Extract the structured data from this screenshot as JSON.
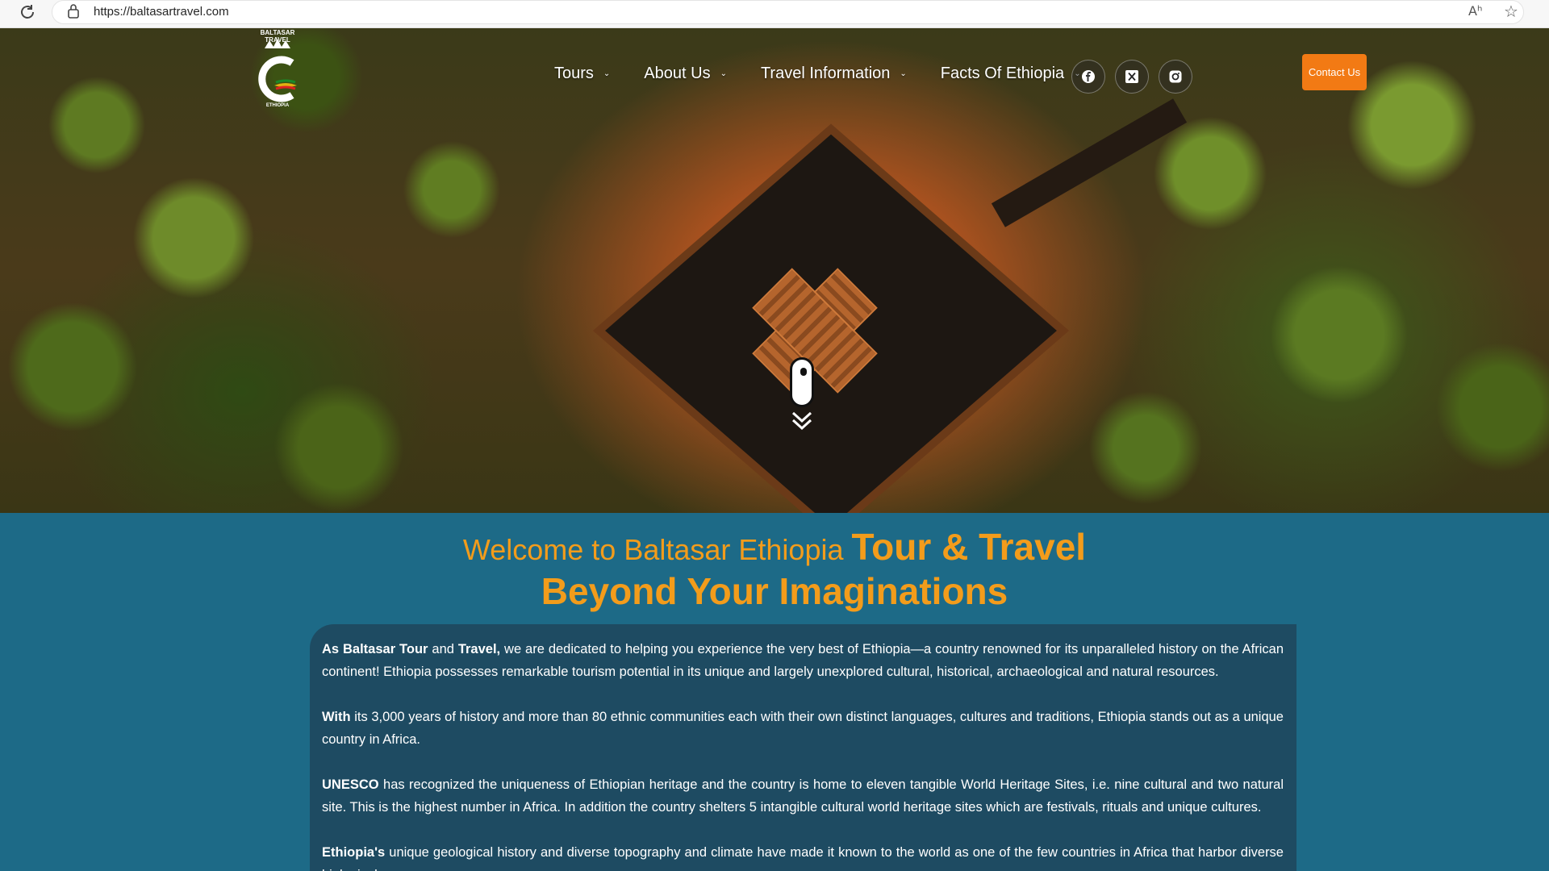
{
  "browser": {
    "url": "https://baltasartravel.com",
    "read_aloud_icon": "Aʰ",
    "favorite_icon": "☆"
  },
  "logo": {
    "top_text": "BALTASAR TRAVEL",
    "bottom_text": "ETHIOPIA"
  },
  "nav": {
    "items": [
      {
        "label": "Tours"
      },
      {
        "label": "About Us"
      },
      {
        "label": "Travel Information"
      },
      {
        "label": "Facts Of Ethiopia"
      }
    ],
    "chevron": "⌄",
    "social": [
      "facebook-icon",
      "x-icon",
      "instagram-icon"
    ],
    "contact_label": "Contact Us"
  },
  "colors": {
    "accent": "#f27a14",
    "heading": "#f39c1b",
    "section_bg": "#1d6a87",
    "card_bg": "#1e4b62"
  },
  "welcome": {
    "line1_light": "Welcome to Baltasar Ethiopia ",
    "line1_bold": "Tour & Travel",
    "line2": "Beyond Your Imaginations"
  },
  "paragraphs": [
    {
      "lead": "As Baltasar Tour",
      "mid": " and ",
      "lead2": "Travel,",
      "text": " we are dedicated to helping you experience the very best of Ethiopia—a country renowned for its unparalleled history on the African continent! Ethiopia possesses remarkable tourism potential in its unique and largely unexplored cultural, historical, archaeological and natural resources."
    },
    {
      "lead": "With",
      "text": " its 3,000 years of history and more than 80 ethnic communities each with their own distinct languages, cultures and traditions, Ethiopia stands out as a unique country in Africa."
    },
    {
      "lead": "UNESCO",
      "text": " has recognized the uniqueness of Ethiopian heritage and the country is home to eleven tangible World Heritage Sites, i.e. nine cultural and two natural site. This is the highest number in Africa. In addition the country shelters 5 intangible cultural world heritage sites which are festivals, rituals and unique cultures."
    },
    {
      "lead": "Ethiopia's",
      "text": " unique geological history and diverse topography and climate have made it known to the world as one of the few countries in Africa that harbor diverse biological"
    }
  ]
}
